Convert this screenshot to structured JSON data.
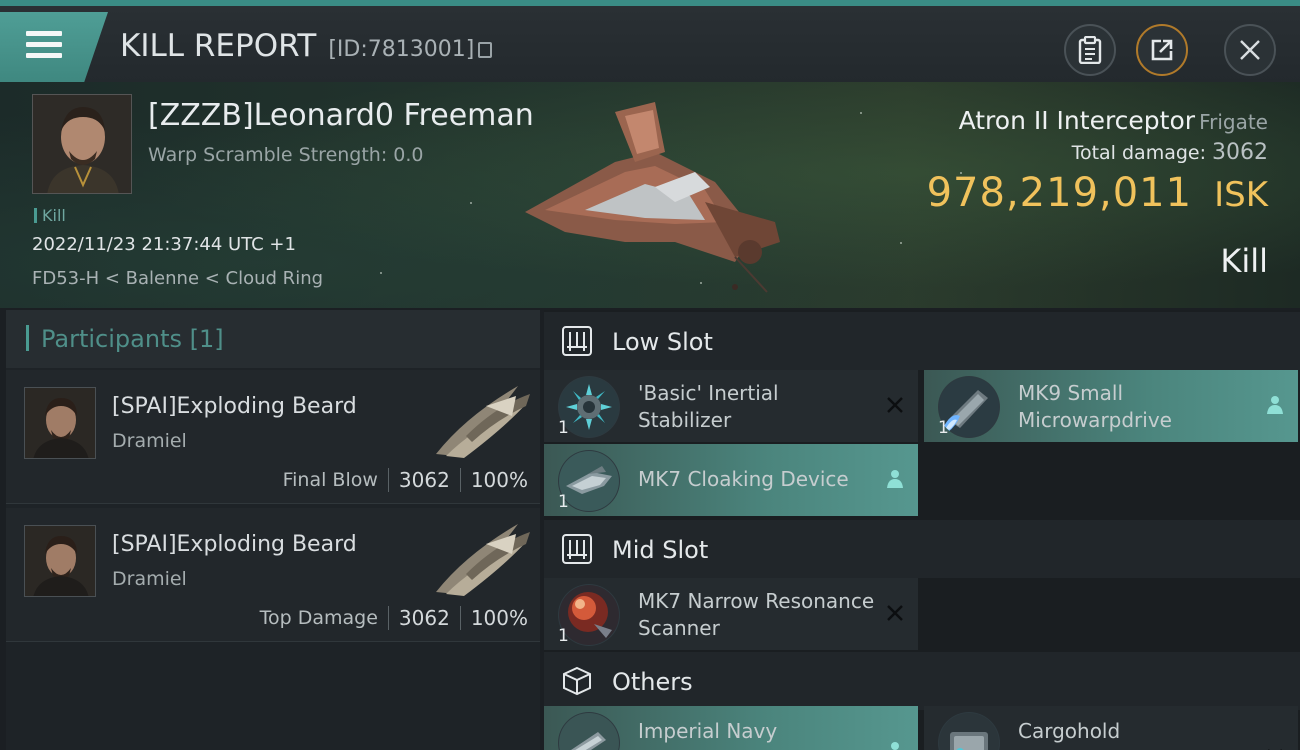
{
  "header": {
    "title": "KILL REPORT",
    "report_id": "[ID:7813001]",
    "icons": [
      "menu-icon",
      "copy-icon",
      "clipboard-icon",
      "share-icon",
      "close-icon"
    ]
  },
  "victim": {
    "name": "[ZZZB]Leonard0 Freeman",
    "warp_scramble": "Warp Scramble Strength: 0.0",
    "tag": "Kill",
    "datetime": "2022/11/23 21:37:44 UTC +1",
    "location": "FD53-H < Balenne < Cloud Ring",
    "ship_name": "Atron II Interceptor",
    "ship_class": "Frigate",
    "total_damage_label": "Total damage:",
    "total_damage_value": "3062",
    "isk_value": "978,219,011",
    "isk_unit": "ISK",
    "result": "Kill"
  },
  "participants": {
    "header": "Participants [1]",
    "items": [
      {
        "name": "[SPAI]Exploding Beard",
        "ship": "Dramiel",
        "label": "Final Blow",
        "damage": "3062",
        "percent": "100%"
      },
      {
        "name": "[SPAI]Exploding Beard",
        "ship": "Dramiel",
        "label": "Top Damage",
        "damage": "3062",
        "percent": "100%"
      }
    ]
  },
  "fitting": {
    "low_slot": {
      "title": "Low Slot",
      "items": [
        {
          "qty": "1",
          "name": "'Basic' Inertial Stabilizer",
          "status": "destroyed"
        },
        {
          "qty": "1",
          "name": "MK9 Small Microwarpdrive",
          "status": "dropped"
        },
        {
          "qty": "1",
          "name": "MK7 Cloaking Device",
          "status": "dropped"
        }
      ]
    },
    "mid_slot": {
      "title": "Mid Slot",
      "items": [
        {
          "qty": "1",
          "name": "MK7 Narrow Resonance Scanner",
          "status": "destroyed"
        }
      ]
    },
    "others": {
      "title": "Others",
      "items": [
        {
          "qty": "",
          "name": "Imperial Navy",
          "status": "dropped"
        },
        {
          "qty": "",
          "name": "Cargohold",
          "status": "destroyed"
        }
      ]
    }
  },
  "colors": {
    "accent": "#4a9b92",
    "isk": "#f0c25c",
    "dropped": "#4b857d"
  }
}
